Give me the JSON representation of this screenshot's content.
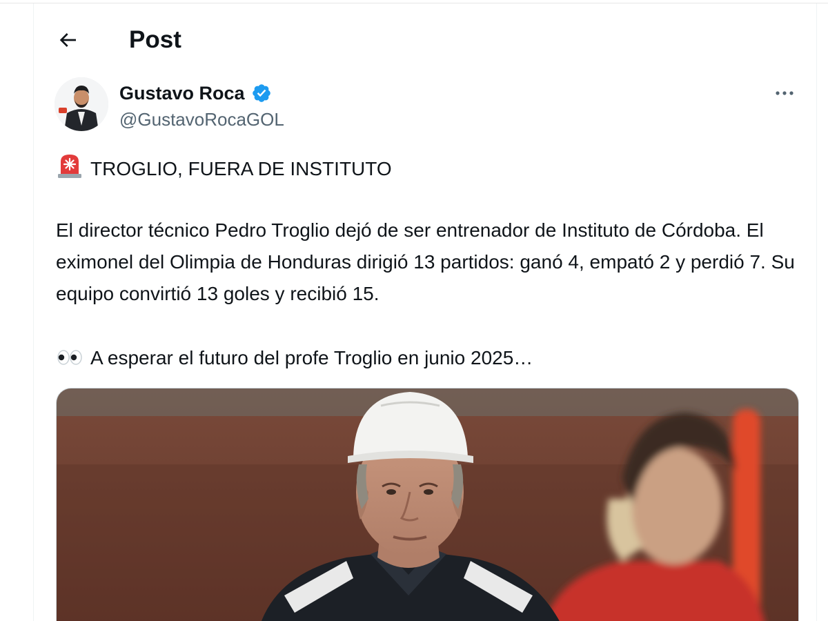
{
  "header": {
    "title": "Post",
    "back_icon": "arrow-left-icon"
  },
  "author": {
    "display_name": "Gustavo Roca",
    "handle": "@GustavoRocaGOL",
    "verified": true,
    "verified_color": "#1d9bf0",
    "avatar_icon": "profile-photo"
  },
  "post": {
    "headline_emoji": "police-light-emoji",
    "headline": "TROGLIO, FUERA DE INSTITUTO",
    "body": "El director técnico Pedro Troglio dejó de ser entrenador de Instituto de Córdoba. El eximonel del Olimpia de Honduras dirigió 13 partidos: ganó 4, empató 2 y perdió 7. Su equipo convirtió 13 goles y recibió 15.",
    "closing_emoji": "eyes-emoji",
    "closing": "A esperar el futuro del profe Troglio en junio 2025…"
  },
  "media": {
    "type": "photo"
  },
  "colors": {
    "text": "#0f1419",
    "secondary_text": "#536471",
    "accent": "#1d9bf0"
  }
}
